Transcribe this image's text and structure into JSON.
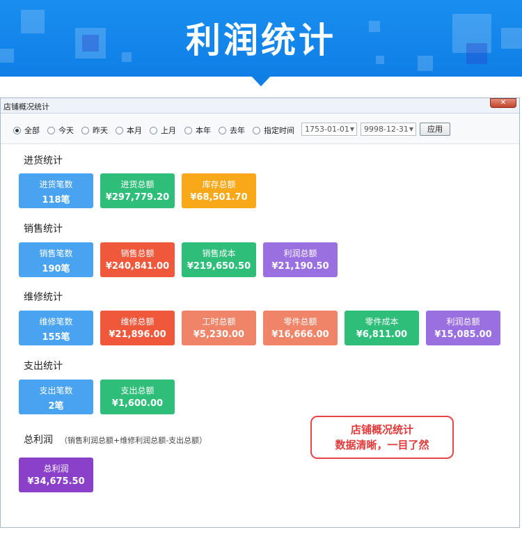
{
  "banner": {
    "title": "利润统计"
  },
  "window": {
    "title": "店铺概况统计",
    "close_icon": "close-icon"
  },
  "filters": {
    "options": [
      {
        "label": "全部",
        "checked": true
      },
      {
        "label": "今天",
        "checked": false
      },
      {
        "label": "昨天",
        "checked": false
      },
      {
        "label": "本月",
        "checked": false
      },
      {
        "label": "上月",
        "checked": false
      },
      {
        "label": "本年",
        "checked": false
      },
      {
        "label": "去年",
        "checked": false
      },
      {
        "label": "指定时间",
        "checked": false
      }
    ],
    "start_date": "1753-01-01",
    "end_date": "9998-12-31",
    "apply_label": "应用"
  },
  "sections": {
    "purchase": {
      "title": "进货统计",
      "cards": [
        {
          "label": "进货笔数",
          "value": "118笔",
          "color": "#4aa3f0"
        },
        {
          "label": "进货总额",
          "value": "¥297,779.20",
          "color": "#2fbe7a"
        },
        {
          "label": "库存总额",
          "value": "¥68,501.70",
          "color": "#f8a818"
        }
      ]
    },
    "sales": {
      "title": "销售统计",
      "cards": [
        {
          "label": "销售笔数",
          "value": "190笔",
          "color": "#4aa3f0"
        },
        {
          "label": "销售总额",
          "value": "¥240,841.00",
          "color": "#f0583c"
        },
        {
          "label": "销售成本",
          "value": "¥219,650.50",
          "color": "#2fbe7a"
        },
        {
          "label": "利润总额",
          "value": "¥21,190.50",
          "color": "#9a6fe0"
        }
      ]
    },
    "repair": {
      "title": "维修统计",
      "cards": [
        {
          "label": "维修笔数",
          "value": "155笔",
          "color": "#4aa3f0"
        },
        {
          "label": "维修总额",
          "value": "¥21,896.00",
          "color": "#f0583c"
        },
        {
          "label": "工时总额",
          "value": "¥5,230.00",
          "color": "#ef8468"
        },
        {
          "label": "零件总额",
          "value": "¥16,666.00",
          "color": "#ef8468"
        },
        {
          "label": "零件成本",
          "value": "¥6,811.00",
          "color": "#2fbe7a"
        },
        {
          "label": "利润总额",
          "value": "¥15,085.00",
          "color": "#9a6fe0"
        }
      ]
    },
    "expense": {
      "title": "支出统计",
      "cards": [
        {
          "label": "支出笔数",
          "value": "2笔",
          "color": "#4aa3f0"
        },
        {
          "label": "支出总额",
          "value": "¥1,600.00",
          "color": "#2fbe7a"
        }
      ]
    },
    "total": {
      "title": "总利润",
      "note": "（销售利润总额+维修利润总额-支出总额）",
      "cards": [
        {
          "label": "总利润",
          "value": "¥34,675.50",
          "color": "#8a40c8"
        }
      ]
    }
  },
  "callout": {
    "line1": "店铺概况统计",
    "line2": "数据清晰，一目了然"
  }
}
